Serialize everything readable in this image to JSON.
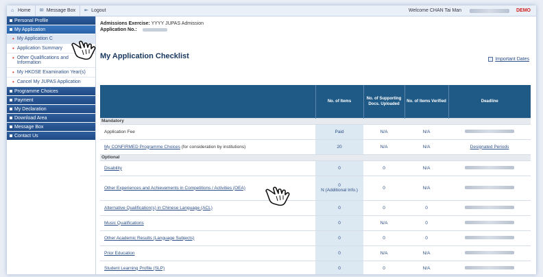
{
  "topbar": {
    "home": "Home",
    "message_box": "Message Box",
    "logout": "Logout",
    "welcome": "Welcome CHAN Tai Man",
    "demo": "DEMO"
  },
  "sidebar": {
    "personal_profile": "Personal Profile",
    "my_application": "My Application",
    "sub_items": [
      "My Application Checklist",
      "Application Summary",
      "Other Qualifications and Information",
      "My HKDSE Examination Year(s)",
      "Cancel My JUPAS Application"
    ],
    "sub_items_visible": [
      "My Application C",
      "Application Summary",
      "Other Qualifications and Information",
      "My HKDSE Examination Year(s)",
      "Cancel My JUPAS Application"
    ],
    "programme_choices": "Programme Choices",
    "payment": "Payment",
    "my_declaration": "My Declaration",
    "download_area": "Download Area",
    "message_box": "Message Box",
    "contact_us": "Contact Us"
  },
  "header": {
    "exercise_label": "Admissions Exercise:",
    "exercise_value": "YYYY JUPAS Admission",
    "appno_label": "Application No.:",
    "title": "My Application Checklist",
    "important_dates": "Important Dates"
  },
  "table": {
    "columns": [
      "",
      "No. of Items",
      "No. of Supporting Docs. Uploaded",
      "No. of Items Verified",
      "Deadline"
    ],
    "mandatory_label": "Mandatory",
    "optional_label": "Optional",
    "mandatory_rows": [
      {
        "item": "Application Fee",
        "link": false,
        "items": "Paid",
        "docs": "N/A",
        "verified": "N/A",
        "deadline": ""
      },
      {
        "item": "My CONFIRMED Programme Choices",
        "suffix": "(for consideration by institutions)",
        "link": true,
        "items": "20",
        "docs": "N/A",
        "verified": "N/A",
        "deadline": "Designated Periods"
      }
    ],
    "optional_rows": [
      {
        "item": "Disability",
        "items": "0",
        "docs": "0",
        "verified": "N/A"
      },
      {
        "item": "Other Experiences and Achievements in Competitions / Activities (OEA)",
        "items": "0",
        "items_note": "N (Additional Info.)",
        "docs": "0",
        "verified": "N/A"
      },
      {
        "item": "Alternative Qualification(s) in Chinese Language (ACL)",
        "items": "0",
        "docs": "0",
        "verified": "0"
      },
      {
        "item": "Music Qualifications",
        "items": "0",
        "docs": "N/A",
        "verified": "0"
      },
      {
        "item": "Other Academic Results (Language Subjects)",
        "items": "0",
        "docs": "0",
        "verified": "0"
      },
      {
        "item": "Prior Education",
        "items": "0",
        "docs": "N/A",
        "verified": "N/A"
      },
      {
        "item": "Student Learning Profile (SLP)",
        "items": "0",
        "docs": "0",
        "verified": "N/A"
      }
    ]
  },
  "colors": {
    "nav_blue": "#1f4a85",
    "table_header": "#1f5a86",
    "demo_red": "#d01c1c",
    "title_navy": "#17365d"
  }
}
